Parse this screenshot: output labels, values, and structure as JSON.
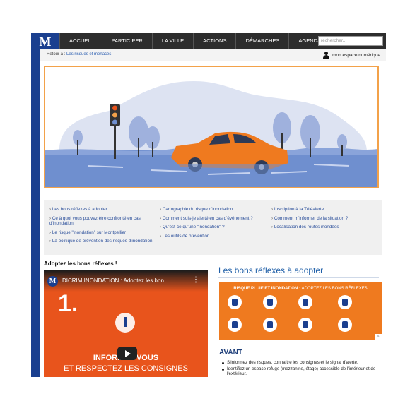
{
  "logo": "M",
  "nav": {
    "items": [
      "ACCUEIL",
      "PARTICIPER",
      "LA VILLE",
      "ACTIONS",
      "DÉMARCHES",
      "AGENDA"
    ],
    "search_placeholder": "rechercher..."
  },
  "subbar": {
    "breadcrumb_prefix": "Retour à :",
    "breadcrumb_link": "Les risques et menaces",
    "account_label": "mon espace numérique"
  },
  "links": {
    "col1": [
      "Les bons réflexes à adopter",
      "Ce à quoi vous pouvez être confronté en cas d'inondation",
      "Le risque \"inondation\" sur Montpellier",
      "La politique de prévention des risques d'inondation"
    ],
    "col2": [
      "Cartographie du risque d'inondation",
      "Comment suis-je alerté en cas d'événement ?",
      "Qu'est-ce qu'une \"inondation\" ?",
      "Les outils de prévention"
    ],
    "col3": [
      "Inscription à la Téléalerte",
      "Comment m'informer de la situation ?",
      "Localisation des routes inondées"
    ]
  },
  "video": {
    "section_title": "Adoptez les bons réflexes !",
    "title": "DICRIM INONDATION : Adoptez les bon...",
    "number": "1.",
    "line1": "INFORMEZ-VOUS",
    "line2": "ET RESPECTEZ LES CONSIGNES"
  },
  "right": {
    "title": "Les bons réflexes à adopter",
    "poster_title_bold": "RISQUE PLUIE ET INONDATION :",
    "poster_title_rest": "ADOPTEZ LES BONS RÉFLEXES",
    "avant": "AVANT",
    "bullets": [
      "S'informez des risques, connaître les consignes et le signal d'alerte.",
      "Identifiez un espace refuge (mezzanine, étage) accessible de l'intérieur et de l'extérieur."
    ]
  },
  "colors": {
    "brand_blue": "#1a3f8f",
    "nav_dark": "#2d2d2d",
    "orange": "#ef7a1f",
    "hero_border": "#f3a24a"
  }
}
